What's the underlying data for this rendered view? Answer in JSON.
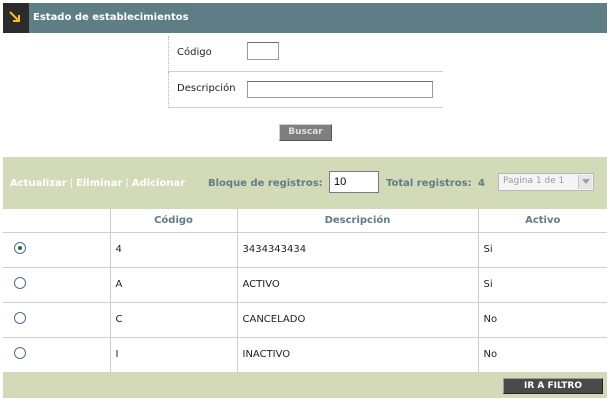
{
  "header": {
    "title": "Estado de establecimientos",
    "icon": "arrow-down-right-icon",
    "accent": "#5e7d85"
  },
  "filter": {
    "codigo_label": "Código",
    "codigo_value": "",
    "descripcion_label": "Descripción",
    "descripcion_value": "",
    "buscar_label": "Buscar"
  },
  "toolbar": {
    "actions": [
      "Actualizar",
      "Eliminar",
      "Adicionar"
    ],
    "bloque_label": "Bloque de registros:",
    "bloque_value": "10",
    "total_label": "Total registros:",
    "total_value": "4",
    "pagina_select": "Pagina 1 de 1",
    "bg_color": "#d3dab8"
  },
  "table": {
    "headers": [
      "",
      "Código",
      "Descripción",
      "Activo"
    ],
    "rows": [
      {
        "selected": true,
        "codigo": "4",
        "descripcion": "3434343434",
        "activo": "Si"
      },
      {
        "selected": false,
        "codigo": "A",
        "descripcion": "ACTIVO",
        "activo": "Si"
      },
      {
        "selected": false,
        "codigo": "C",
        "descripcion": "CANCELADO",
        "activo": "No"
      },
      {
        "selected": false,
        "codigo": "I",
        "descripcion": "INACTIVO",
        "activo": "No"
      }
    ]
  },
  "footer": {
    "ir_filtro_label": "IR A FILTRO"
  }
}
